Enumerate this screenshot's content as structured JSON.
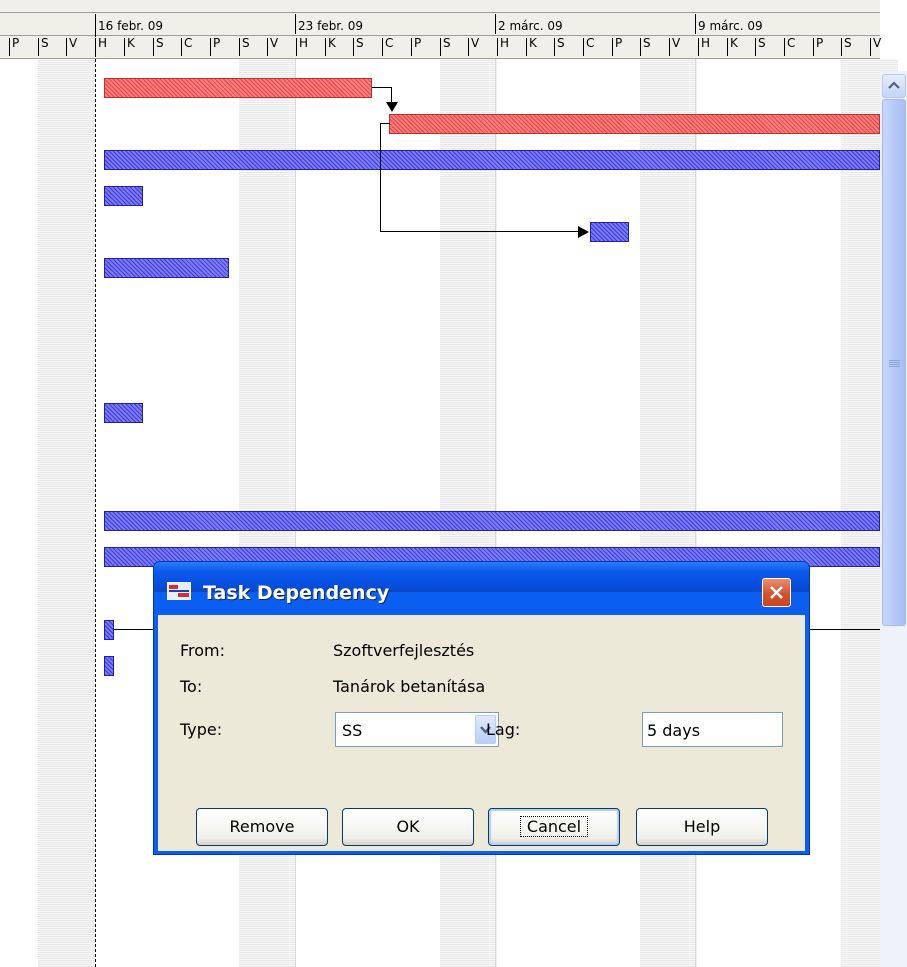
{
  "timeline": {
    "weeks": [
      "16 febr. 09",
      "23 febr. 09",
      "2 márc. 09",
      "9 márc. 09"
    ],
    "day_letters": [
      "P",
      "S",
      "V",
      "H",
      "K",
      "S",
      "C",
      "P",
      "S",
      "V",
      "H",
      "K",
      "S",
      "C",
      "P",
      "S",
      "V",
      "H",
      "K",
      "S",
      "C",
      "P",
      "S",
      "V",
      "H",
      "K",
      "S",
      "C",
      "P",
      "S",
      "V"
    ]
  },
  "colors": {
    "critical_bar": "#ef4040",
    "task_bar": "#3b3bdf",
    "dialog_title": "#0a5ef0",
    "dialog_face": "#ece9d8"
  },
  "icons": {
    "scroll_up": "chevron-up-icon",
    "scroll_thumb": "grip-icon",
    "app": "task-dependency-icon",
    "close": "close-x-icon",
    "dropdown": "chevron-down-icon"
  },
  "dialog": {
    "title": "Task Dependency",
    "from_label": "From:",
    "from_value": "Szoftverfejlesztés",
    "to_label": "To:",
    "to_value": "Tanárok betanítása",
    "type_label": "Type:",
    "type_value": "SS",
    "lag_label": "Lag:",
    "lag_value": "5 days",
    "buttons": {
      "remove": "Remove",
      "ok": "OK",
      "cancel": "Cancel",
      "help": "Help"
    }
  }
}
